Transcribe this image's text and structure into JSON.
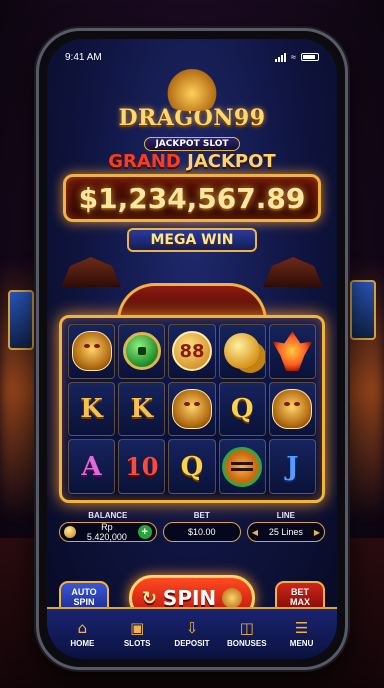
{
  "status_bar": {
    "time": "9:41 AM"
  },
  "logo": {
    "title": "DRAGON99",
    "subtitle": "JACKPOT SLOT"
  },
  "jackpot": {
    "grand_word": "GRAND",
    "jackpot_word": "JACKPOT",
    "amount": "$1,234,567.89",
    "banner": "MEGA WIN"
  },
  "reels": {
    "rows": [
      [
        "dragon",
        "jade-coin",
        "88-coin",
        "gold-coins",
        "phoenix"
      ],
      [
        "K",
        "K",
        "dragon",
        "Q",
        "dragon"
      ],
      [
        "A",
        "10",
        "Q",
        "tiger",
        "J"
      ]
    ]
  },
  "info": {
    "balance_label": "BALANCE",
    "balance_value": "Rp 5.420,000",
    "bet_label": "BET",
    "bet_value": "$10.00",
    "line_label": "LINE",
    "line_value": "25 Lines"
  },
  "controls": {
    "auto_spin_line1": "AUTO",
    "auto_spin_line2": "SPIN",
    "spin_label": "SPIN",
    "bet_max_line1": "BET",
    "bet_max_line2": "MAX"
  },
  "nav": [
    {
      "label": "HOME",
      "icon": "home-icon"
    },
    {
      "label": "SLOTS",
      "icon": "slot-machine-icon"
    },
    {
      "label": "DEPOSIT",
      "icon": "deposit-icon"
    },
    {
      "label": "BONUSES",
      "icon": "gift-icon"
    },
    {
      "label": "MENU",
      "icon": "menu-icon"
    }
  ],
  "colors": {
    "gold": "#f1b440",
    "spin_red": "#d0241a",
    "panel_blue": "#101542"
  }
}
